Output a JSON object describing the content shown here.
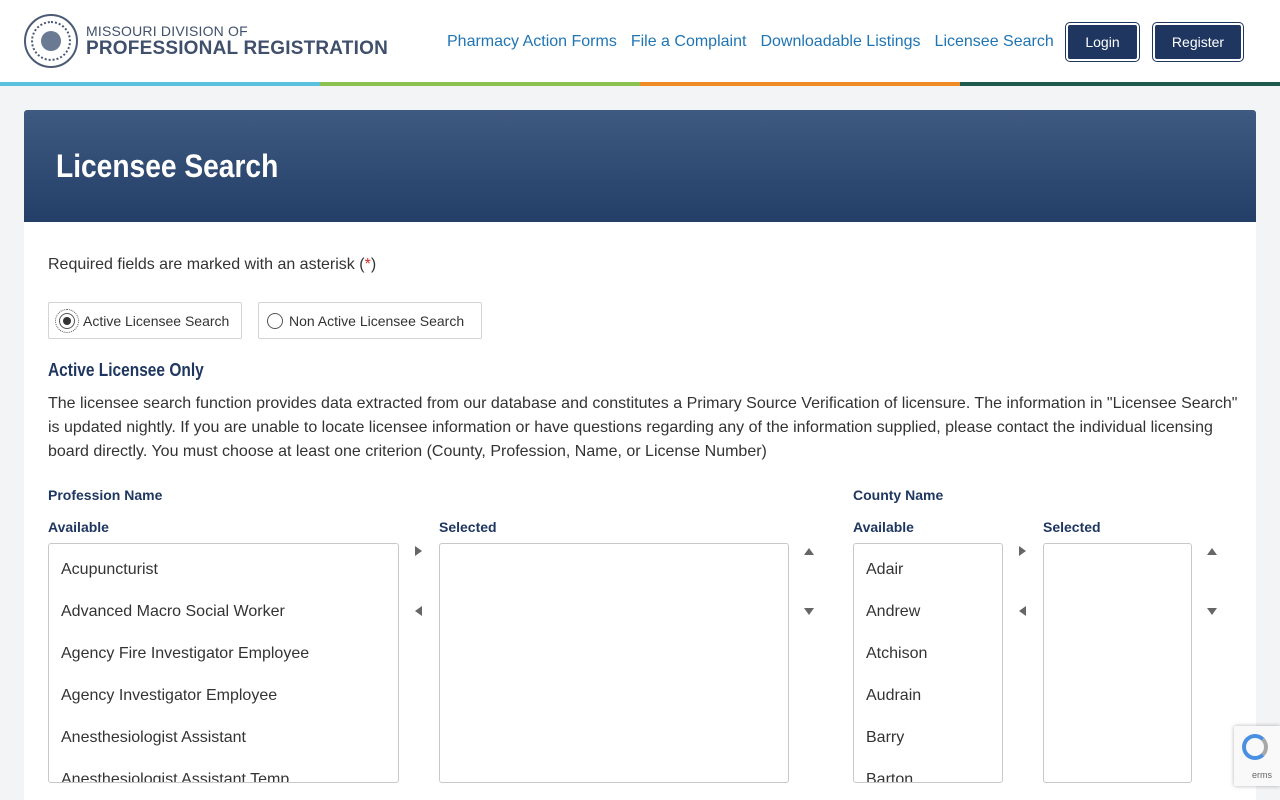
{
  "header": {
    "logo_line1": "MISSOURI DIVISION OF",
    "logo_line2": "PROFESSIONAL REGISTRATION",
    "nav": [
      {
        "label": "Pharmacy Action Forms"
      },
      {
        "label": "File a Complaint"
      },
      {
        "label": "Downloadable Listings"
      },
      {
        "label": "Licensee Search"
      }
    ],
    "login_label": "Login",
    "register_label": "Register",
    "colorbar": [
      "#5bc0de",
      "#8cc152",
      "#f08a24",
      "#1e5a4e"
    ]
  },
  "page": {
    "title": "Licensee Search",
    "required_note_prefix": "Required fields are marked with an asterisk (",
    "required_star": "*",
    "required_note_suffix": ")",
    "radio_active_label": "Active Licensee Search",
    "radio_inactive_label": "Non Active Licensee Search",
    "radio_selected": "Active Licensee Search",
    "section_title": "Active Licensee Only",
    "description": "The licensee search function provides data extracted from our database and constitutes a Primary Source Verification of licensure. The information in \"Licensee Search\" is updated nightly. If you are unable to locate licensee information or have questions regarding any of the information supplied, please contact the individual licensing board directly. You must choose at least one criterion (County, Profession, Name, or License Number)"
  },
  "profession": {
    "title": "Profession Name",
    "available_label": "Available",
    "selected_label": "Selected",
    "available": [
      "Acupuncturist",
      "Advanced Macro Social Worker",
      "Agency Fire Investigator Employee",
      "Agency Investigator Employee",
      "Anesthesiologist Assistant",
      "Anesthesiologist Assistant Temp"
    ],
    "selected": []
  },
  "county": {
    "title": "County Name",
    "available_label": "Available",
    "selected_label": "Selected",
    "available": [
      "Adair",
      "Andrew",
      "Atchison",
      "Audrain",
      "Barry",
      "Barton"
    ],
    "selected": []
  },
  "recaptcha": {
    "text": "erms"
  }
}
